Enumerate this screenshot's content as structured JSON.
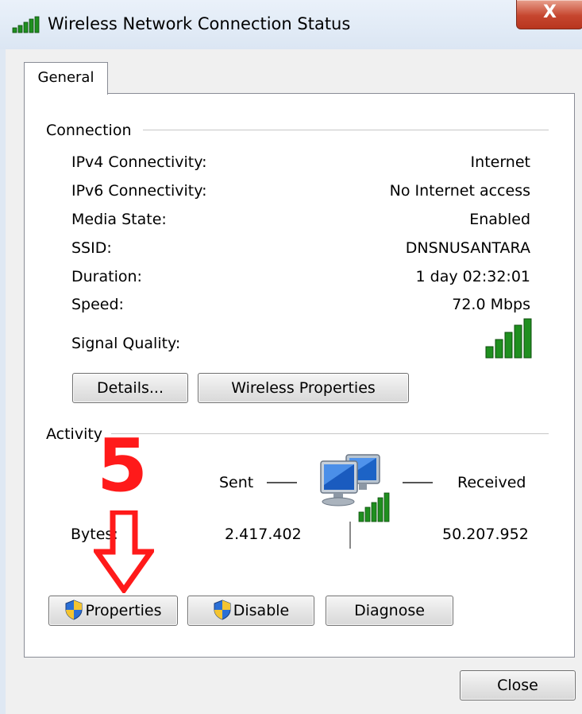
{
  "window": {
    "title": "Wireless Network Connection Status",
    "close_glyph": "X"
  },
  "tabs": [
    {
      "label": "General",
      "selected": true
    }
  ],
  "connection": {
    "heading": "Connection",
    "rows": [
      {
        "label": "IPv4 Connectivity:",
        "value": "Internet"
      },
      {
        "label": "IPv6 Connectivity:",
        "value": "No Internet access"
      },
      {
        "label": "Media State:",
        "value": "Enabled"
      },
      {
        "label": "SSID:",
        "value": "DNSNUSANTARA"
      },
      {
        "label": "Duration:",
        "value": "1 day 02:32:01"
      },
      {
        "label": "Speed:",
        "value": "72.0 Mbps"
      }
    ],
    "signal_label": "Signal Quality:",
    "signal_bars": 5,
    "details_button": "Details...",
    "wireless_properties_button": "Wireless Properties"
  },
  "activity": {
    "heading": "Activity",
    "sent_label": "Sent",
    "received_label": "Received",
    "bytes_label": "Bytes:",
    "bytes_sent": "2.417.402",
    "bytes_received": "50.207.952",
    "properties_button": "Properties",
    "disable_button": "Disable",
    "diagnose_button": "Diagnose"
  },
  "footer": {
    "close_button": "Close"
  },
  "annotation": {
    "number": "5",
    "color": "#ff1a1a"
  },
  "colors": {
    "signal_green": "#1f8f1f",
    "shield_blue": "#2a6fd6",
    "shield_yellow": "#f4c430"
  }
}
